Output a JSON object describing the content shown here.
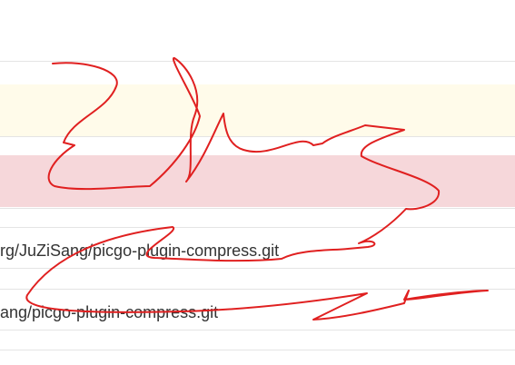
{
  "rows": [
    {
      "text": "rg/JuZiSang/picgo-plugin-compress.git"
    },
    {
      "text": "ang/picgo-plugin-compress.git"
    }
  ],
  "colors": {
    "warning_row_bg": "#fffbea",
    "danger_row_bg": "#f6d7da",
    "divider": "#e4e4e4",
    "scribble": "#e02020",
    "text": "#333333"
  },
  "icons": {
    "overlay": "red-scribble-annotation"
  }
}
